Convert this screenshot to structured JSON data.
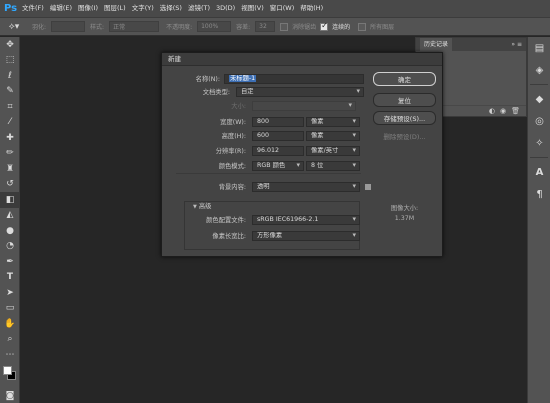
{
  "menu": {
    "logo": "Ps",
    "items": [
      "文件(F)",
      "编辑(E)",
      "图像(I)",
      "图层(L)",
      "文字(Y)",
      "选择(S)",
      "滤镜(T)",
      "3D(D)",
      "视图(V)",
      "窗口(W)",
      "帮助(H)"
    ]
  },
  "options": {
    "tool_icon": "magic-eraser-icon",
    "feather_label": "羽化:",
    "style_label": "样式:",
    "style_value": "正常",
    "opacity_label": "不透明度:",
    "opacity_value": "100%",
    "tolerance_label": "容差:",
    "tolerance_value": "32",
    "antialias_label": "消除锯齿",
    "contiguous_label": "连续的",
    "all_layers_label": "所有图层"
  },
  "history_panel": {
    "title": "历史记录"
  },
  "dialog": {
    "title": "新建",
    "name_label": "名称(N):",
    "name_value": "未标题-1",
    "preset_label": "文档类型:",
    "preset_value": "自定",
    "size_label": "大小:",
    "width_label": "宽度(W):",
    "width_value": "800",
    "width_unit": "像素",
    "height_label": "高度(H):",
    "height_value": "600",
    "height_unit": "像素",
    "resolution_label": "分辨率(R):",
    "resolution_value": "96.012",
    "resolution_unit": "像素/英寸",
    "colormode_label": "颜色模式:",
    "colormode_value": "RGB 颜色",
    "bitdepth_value": "8 位",
    "background_label": "背景内容:",
    "background_value": "透明",
    "advanced_label": "高级",
    "profile_label": "颜色配置文件:",
    "profile_value": "sRGB IEC61966-2.1",
    "pixel_aspect_label": "像素长宽比:",
    "pixel_aspect_value": "方形像素",
    "ok_button": "确定",
    "reset_button": "复位",
    "save_preset_button": "存储预设(S)...",
    "delete_preset_button": "删除预设(D)...",
    "image_size_label": "图像大小:",
    "image_size_value": "1.37M"
  }
}
